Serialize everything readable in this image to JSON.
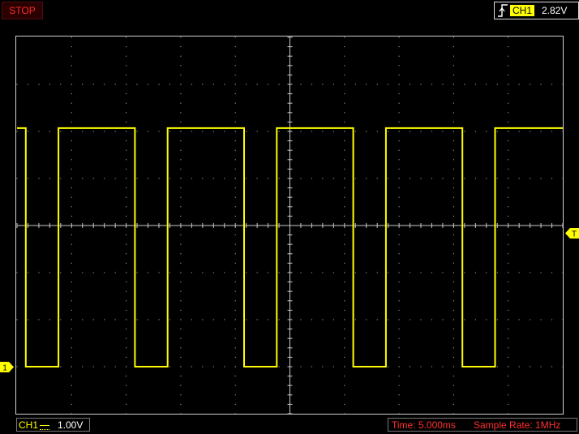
{
  "status": {
    "run_state": "STOP"
  },
  "trigger": {
    "icon": "rising-edge-trigger-icon",
    "channel": "CH1",
    "level": "2.82V"
  },
  "markers": {
    "ch1_ground": "1",
    "trigger_level": "T"
  },
  "channel_scale": {
    "channel": "CH1",
    "coupling_icon": "dc-coupling-icon",
    "volts_per_div": "1.00V"
  },
  "timebase": {
    "time": "Time: 5.000ms",
    "sample_rate": "Sample Rate: 1MHz"
  },
  "colors": {
    "trace": "#ffff00",
    "grid": "#c8c8c8",
    "stop": "#ff2b2b",
    "time_text": "#ff3030",
    "background": "#000000"
  },
  "chart_data": {
    "type": "line",
    "title": "",
    "xlabel": "",
    "ylabel": "",
    "x_divisions": 10,
    "y_divisions": 8,
    "x_unit": "ms",
    "x_per_div": 5,
    "y_unit": "V",
    "y_per_div": 1,
    "xlim": [
      0,
      50
    ],
    "ylim": [
      -4,
      4
    ],
    "grid": true,
    "series": [
      {
        "x": [
          0,
          0.8,
          0.8,
          3.8,
          3.8,
          10.8,
          10.8,
          13.8,
          13.8,
          20.8,
          20.8,
          23.8,
          23.8,
          30.8,
          30.8,
          33.8,
          33.8,
          40.8,
          40.8,
          43.8,
          43.8,
          50
        ],
        "y": [
          2.07,
          2.07,
          -3.0,
          -3.0,
          2.07,
          2.07,
          -3.0,
          -3.0,
          2.07,
          2.07,
          -3.0,
          -3.0,
          2.07,
          2.07,
          -3.0,
          -3.0,
          2.07,
          2.07,
          -3.0,
          -3.0,
          2.07,
          2.07
        ]
      }
    ]
  }
}
